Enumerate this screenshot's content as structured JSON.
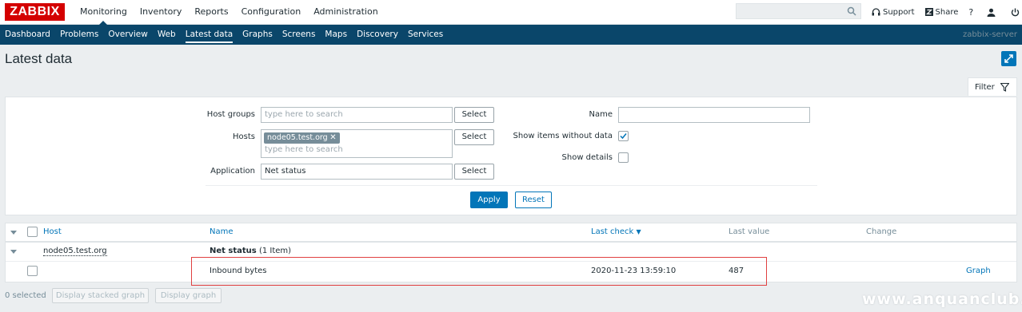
{
  "app": {
    "logo": "ZABBIX",
    "server": "zabbix-server"
  },
  "top_menu": [
    {
      "label": "Monitoring",
      "active": true
    },
    {
      "label": "Inventory"
    },
    {
      "label": "Reports"
    },
    {
      "label": "Configuration"
    },
    {
      "label": "Administration"
    }
  ],
  "top_links": {
    "support": "Support",
    "share": "Share",
    "help": "?"
  },
  "sub_menu": [
    {
      "label": "Dashboard"
    },
    {
      "label": "Problems"
    },
    {
      "label": "Overview"
    },
    {
      "label": "Web"
    },
    {
      "label": "Latest data",
      "active": true
    },
    {
      "label": "Graphs"
    },
    {
      "label": "Screens"
    },
    {
      "label": "Maps"
    },
    {
      "label": "Discovery"
    },
    {
      "label": "Services"
    }
  ],
  "page_title": "Latest data",
  "filter": {
    "tab_label": "Filter",
    "host_groups_label": "Host groups",
    "host_groups_placeholder": "type here to search",
    "hosts_label": "Hosts",
    "hosts_selected": "node05.test.org",
    "hosts_placeholder": "type here to search",
    "application_label": "Application",
    "application_value": "Net status",
    "select_label": "Select",
    "name_label": "Name",
    "name_value": "",
    "show_without_data_label": "Show items without data",
    "show_without_data_checked": true,
    "show_details_label": "Show details",
    "show_details_checked": false,
    "apply_label": "Apply",
    "reset_label": "Reset"
  },
  "table": {
    "headers": {
      "host": "Host",
      "name": "Name",
      "last_check": "Last check",
      "last_value": "Last value",
      "change": "Change"
    },
    "host_row": {
      "host": "node05.test.org",
      "app": "Net status",
      "count": "(1 Item)"
    },
    "item_row": {
      "name": "Inbound bytes",
      "last_check": "2020-11-23 13:59:10",
      "last_value": "487",
      "change": "",
      "graph": "Graph"
    }
  },
  "footer": {
    "selected": "0 selected",
    "stacked_btn": "Display stacked graph",
    "graph_btn": "Display graph"
  },
  "watermark": "www.anquanclub.cn"
}
